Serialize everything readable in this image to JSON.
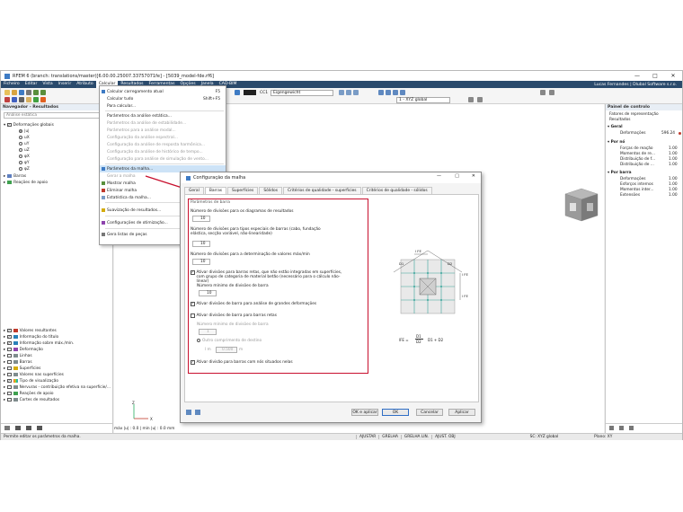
{
  "app": {
    "title": "RFEM 6 (branch: translations/master)[6.00.00.25007.33757071fe] - [5039_model-fde.rf6]",
    "window_controls": [
      "—",
      "□",
      "✕"
    ]
  },
  "menubar": {
    "items": [
      "Ficheiro",
      "Editar",
      "Vista",
      "Inserir",
      "Atributo",
      "Calcular",
      "Resultados",
      "Ferramentas",
      "Opções",
      "Janela",
      "CAD-BIM"
    ],
    "active": "Calcular",
    "user": "Lucas Fernandes | Dlubal Software s.r.o."
  },
  "toolbar": {
    "load_case": "CC1",
    "load_case_name": "Eigengewicht",
    "view": "1 - XYZ global"
  },
  "navigator": {
    "title": "Navegador - Resultados",
    "subtitle": "Análise estática",
    "tree": [
      {
        "label": "Deformações globais",
        "checked": true
      },
      {
        "label": "|u|",
        "selected": true
      },
      {
        "label": "uX"
      },
      {
        "label": "uY"
      },
      {
        "label": "uZ"
      },
      {
        "label": "φX"
      },
      {
        "label": "φY"
      },
      {
        "label": "φZ"
      },
      {
        "label": "Barras"
      },
      {
        "label": "Reações de apoio"
      }
    ],
    "bottom_items": [
      {
        "label": "Valores resultantes",
        "checked": true
      },
      {
        "label": "Informação do título",
        "checked": true
      },
      {
        "label": "Informação sobre máx./mín.",
        "checked": true
      },
      {
        "label": "Deformação",
        "checked": false
      },
      {
        "label": "Linhas",
        "checked": false
      },
      {
        "label": "Barras",
        "checked": false
      },
      {
        "label": "Superfícies",
        "checked": false
      },
      {
        "label": "Valores nas superfícies",
        "checked": false
      },
      {
        "label": "Tipo de visualização",
        "checked": true
      },
      {
        "label": "Nervuras - contribuição efetiva na superfície/...",
        "checked": false
      },
      {
        "label": "Reações de apoio",
        "checked": false
      },
      {
        "label": "Cortes de resultados",
        "checked": false
      }
    ]
  },
  "dropdown": {
    "items": [
      {
        "label": "Calcular carregamento atual",
        "shortcut": "F5",
        "enabled": true
      },
      {
        "label": "Calcular tudo",
        "shortcut": "Shift+F5",
        "enabled": true
      },
      {
        "label": "Para calcular...",
        "enabled": true
      },
      {
        "label": "Parâmetros da análise estática...",
        "enabled": true
      },
      {
        "label": "Parâmetros da análise de estabilidade...",
        "enabled": false
      },
      {
        "label": "Parâmetros para a análise modal...",
        "enabled": false
      },
      {
        "label": "Configuração da análise espectral...",
        "enabled": false
      },
      {
        "label": "Configuração da análise de resposta harmônica...",
        "enabled": false
      },
      {
        "label": "Configuração da análise de histórico de tempo...",
        "enabled": false
      },
      {
        "label": "Configuração para análise de simulação de vento...",
        "enabled": false
      },
      {
        "label": "Parâmetros da malha...",
        "enabled": true,
        "highlighted": true
      },
      {
        "label": "Gerar a malha",
        "enabled": false
      },
      {
        "label": "Mostrar malha",
        "enabled": true
      },
      {
        "label": "Eliminar malha",
        "enabled": true
      },
      {
        "label": "Estatística da malha...",
        "enabled": true
      },
      {
        "label": "Suavização de resultados...",
        "enabled": true
      },
      {
        "label": "Configurações de otimização...",
        "enabled": true
      },
      {
        "label": "Gera listas de peças",
        "enabled": true
      }
    ]
  },
  "dialog": {
    "title": "Configuração da malha",
    "tabs": [
      "Geral",
      "Barras",
      "Superfícies",
      "Sólidos",
      "Critérios de qualidade - superfícies",
      "Critérios de qualidade - sólidos"
    ],
    "active_tab": "Barras",
    "section_title": "Parâmetros de barra",
    "fields": {
      "diagram_div_label": "Número de divisões para os diagramas de resultados",
      "diagram_div_value": "10",
      "special_div_label": "Número de divisões para tipos especiais de barras (cabo, fundação elástica, secção variável, não-linearidade)",
      "special_div_value": "10",
      "maxmin_div_label": "Número de divisões para a determinação de valores máx/mín",
      "maxmin_div_value": "10",
      "activate_integrated_label": "Ativar divisões para barras retas, que não estão integradas em superfícies, com grupo de categoria de material betão (necessário para o cálculo não-linear)",
      "activate_integrated_checked": true,
      "min_div_label": "Número mínimo de divisões de barra",
      "min_div_value": "10",
      "large_def_label": "Ativar divisões de barra para análise de grandes deformações",
      "large_def_checked": true,
      "straight_label": "Ativar divisões de barra para barras retas",
      "straight_checked": false,
      "min_div2_label": "Número mínimo de divisões de barra",
      "min_div2_value": "1",
      "other_length_label": "Outro comprimento de destino",
      "lm_label": "l m",
      "lm_value": "0.500",
      "lm_unit": "m",
      "nodes_on_bars_label": "Ativar divisão para barras com nós situados nelas",
      "nodes_on_bars_checked": true
    },
    "diagram_labels": {
      "fe_top": "l FE",
      "fe_right": "l FE",
      "fe_left": "l FE",
      "d1": "D1",
      "d2": "D2",
      "formula_left": "lFE =",
      "formula_num": "D1",
      "formula_den": "D2",
      "formula_right": "D1 + D2"
    },
    "buttons": {
      "ok_apply": "OK e aplicar",
      "ok": "OK",
      "cancel": "Cancelar",
      "apply": "Aplicar"
    }
  },
  "control_panel": {
    "title": "Painel de controlo",
    "subtitle1": "Fatores de representação",
    "subtitle2": "Resultados",
    "groups": [
      {
        "name": "Geral",
        "rows": [
          {
            "label": "Deformações",
            "value": "596.24"
          }
        ]
      },
      {
        "name": "Por nó",
        "rows": [
          {
            "label": "Forças de reação",
            "value": "1.00"
          },
          {
            "label": "Momentos de re...",
            "value": "1.00"
          },
          {
            "label": "Distribuição de f...",
            "value": "1.00"
          },
          {
            "label": "Distribuição de ...",
            "value": "1.00"
          }
        ]
      },
      {
        "name": "Por barra",
        "rows": [
          {
            "label": "Deformações",
            "value": "1.00"
          },
          {
            "label": "Esforços internos",
            "value": "1.00"
          },
          {
            "label": "Momentos inter...",
            "value": "1.00"
          },
          {
            "label": "Extensões",
            "value": "1.00"
          }
        ]
      }
    ]
  },
  "viewport": {
    "axis_x": "X",
    "axis_z": "Z",
    "scale_text": "máx |u| : 0.0 | mín |u| : 0.0 mm"
  },
  "statusbar": {
    "message": "Permite editar os parâmetros da malha.",
    "toggles": [
      "AJUSTAR",
      "GRELHA",
      "GRELHA LIN.",
      "AJUST. OBJ"
    ],
    "cs": "SC: XYZ global",
    "plane": "Plano: XY"
  },
  "colors": {
    "menubar": "#2a4a6c",
    "highlight": "#cde3f7",
    "red_frame": "#c8102e",
    "diagram_line": "#3aa59a"
  }
}
